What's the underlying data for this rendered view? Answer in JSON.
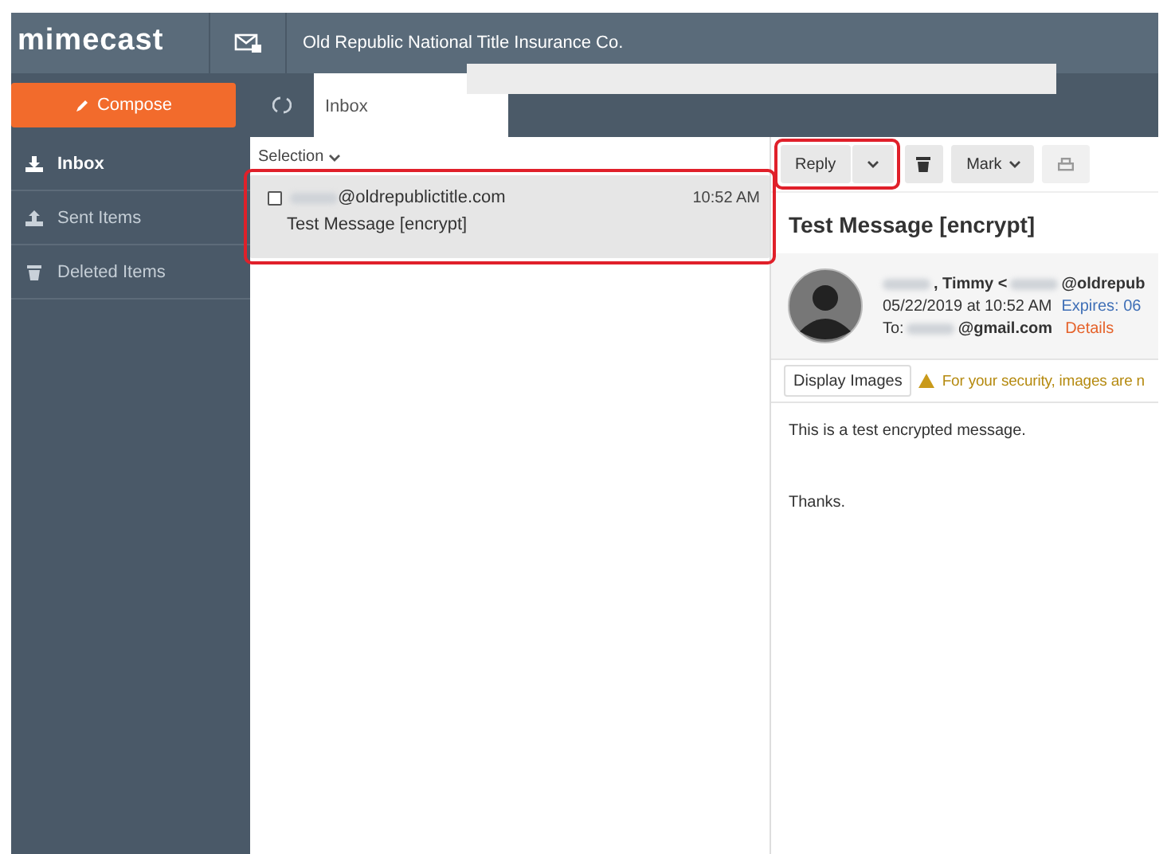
{
  "app": {
    "logo": "mimecast",
    "organization": "Old Republic National Title Insurance Co."
  },
  "compose": {
    "label": "Compose"
  },
  "folders": [
    {
      "kind": "inbox",
      "label": "Inbox",
      "selected": true
    },
    {
      "kind": "sent",
      "label": "Sent Items",
      "selected": false
    },
    {
      "kind": "deleted",
      "label": "Deleted Items",
      "selected": false
    }
  ],
  "tabs": [
    {
      "label": "Inbox",
      "selected": true
    }
  ],
  "list": {
    "selection": "Selection",
    "messages": [
      {
        "sender": "@oldrepublictitle.com",
        "time": "10:52 AM",
        "subject": "Test Message [encrypt]",
        "selected": true,
        "checked": false,
        "highlighted": true
      }
    ]
  },
  "toolbar": {
    "reply": "Reply",
    "reply_highlighted": true,
    "mark": "Mark"
  },
  "message": {
    "subject": "Test Message [encrypt]",
    "sender_name": ", Timmy <",
    "sender_address": "@oldrepub",
    "date": "05/22/2019 at 10:52 AM",
    "expires": "Expires: 06",
    "to_label": "To:",
    "to_address": "@gmail.com",
    "details": "Details",
    "display_images": "Display Images",
    "warning": "For your security, images are n",
    "body": [
      "This is a test encrypted message.",
      "Thanks."
    ]
  }
}
